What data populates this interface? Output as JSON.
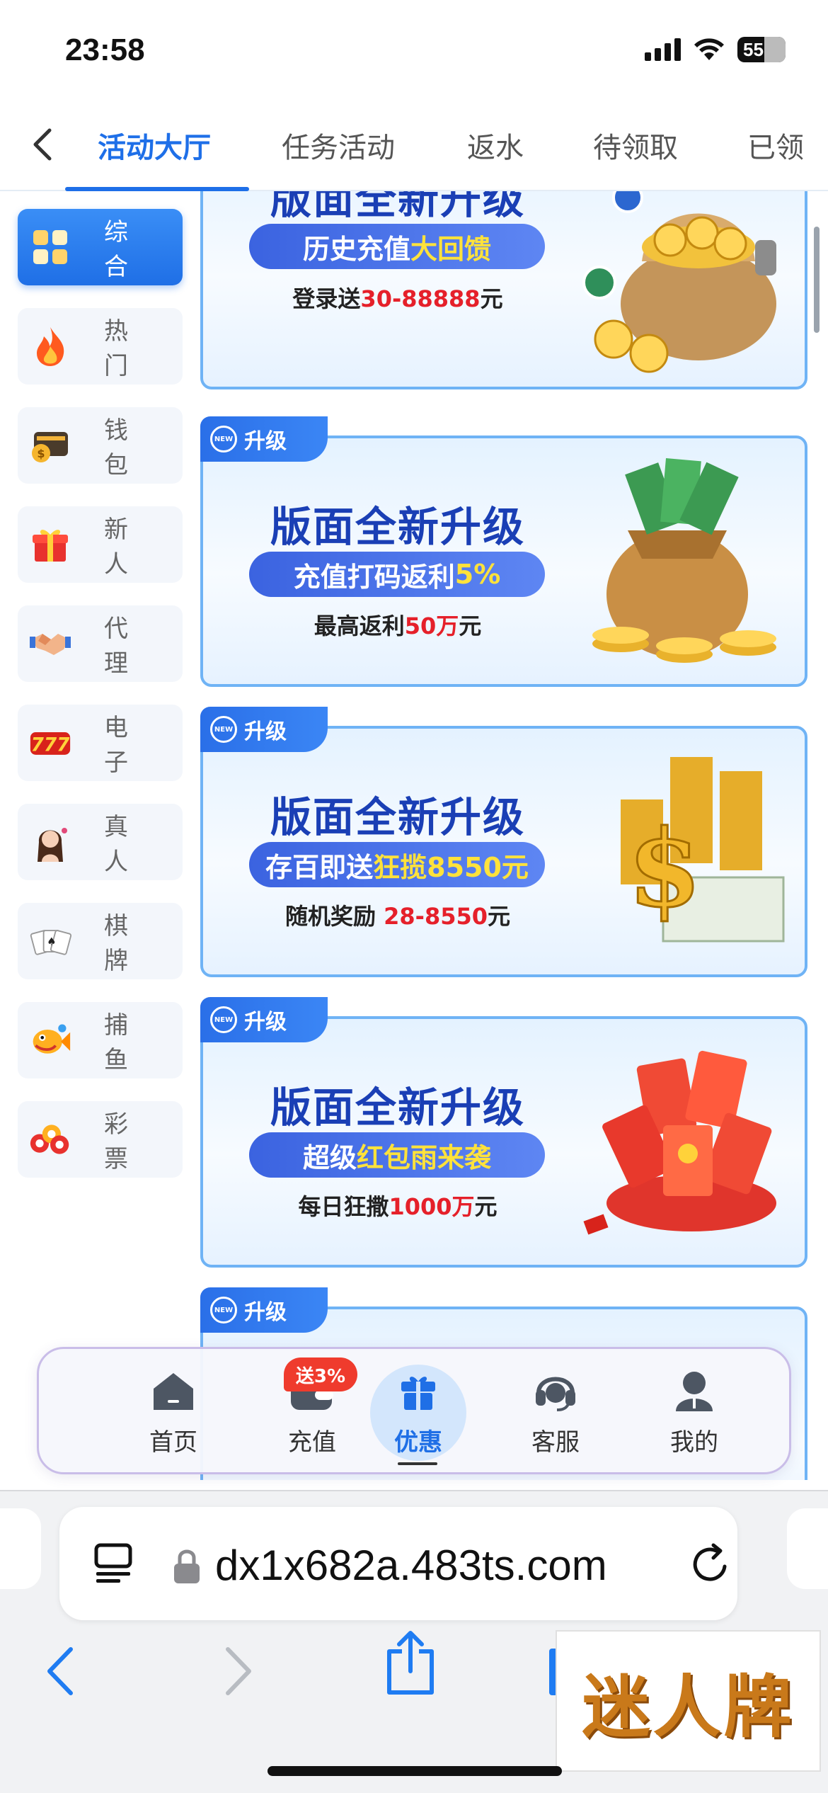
{
  "status_bar": {
    "time": "23:58",
    "battery": "55"
  },
  "tabs": [
    {
      "label": "活动大厅",
      "active": true
    },
    {
      "label": "任务活动",
      "active": false
    },
    {
      "label": "返水",
      "active": false
    },
    {
      "label": "待领取",
      "active": false
    },
    {
      "label": "已领"
    }
  ],
  "sidebar": [
    {
      "label": "综 合",
      "icon": "grid-icon",
      "active": true
    },
    {
      "label": "热 门",
      "icon": "fire-icon"
    },
    {
      "label": "钱 包",
      "icon": "wallet-icon"
    },
    {
      "label": "新 人",
      "icon": "gift-icon"
    },
    {
      "label": "代 理",
      "icon": "handshake-icon"
    },
    {
      "label": "电 子",
      "icon": "slot-777-icon"
    },
    {
      "label": "真 人",
      "icon": "dealer-avatar-icon"
    },
    {
      "label": "棋 牌",
      "icon": "playing-cards-icon"
    },
    {
      "label": "捕 鱼",
      "icon": "fish-icon"
    },
    {
      "label": "彩 票",
      "icon": "lottery-balls-icon"
    }
  ],
  "banners": [
    {
      "badge": "",
      "title": "版面全新升级",
      "pill_pre": "历史充值",
      "pill_hl": "大回馈",
      "sub_pre": "登录送",
      "sub_hl": "30-88888",
      "sub_post": "元",
      "art": "coin-bag"
    },
    {
      "badge": "升级",
      "title": "版面全新升级",
      "pill_pre": "充值打码返利",
      "pill_hl": "5%",
      "sub_pre": "最高返利",
      "sub_hl": "50万",
      "sub_post": "元",
      "art": "money-bag"
    },
    {
      "badge": "升级",
      "title": "版面全新升级",
      "pill_pre": "存百即送 ",
      "pill_hl": "狂揽8550元",
      "sub_pre": "随机奖励 ",
      "sub_hl": "28-8550",
      "sub_post": "元",
      "art": "dollar-coins"
    },
    {
      "badge": "升级",
      "title": "版面全新升级",
      "pill_pre": "超级",
      "pill_hl": "红包雨来袭",
      "sub_pre": "每日狂撒",
      "sub_hl": "1000万",
      "sub_post": "元",
      "art": "red-envelopes"
    },
    {
      "badge": "升级",
      "title": "",
      "pill_pre": "",
      "pill_hl": "",
      "sub_pre": "",
      "sub_hl": "",
      "sub_post": "",
      "art": "partial"
    }
  ],
  "bottom_nav": [
    {
      "label": "首页",
      "icon": "home-icon"
    },
    {
      "label": "充值",
      "icon": "wallet-icon",
      "badge": "送3%"
    },
    {
      "label": "优惠",
      "icon": "gift-box-icon",
      "active": true
    },
    {
      "label": "客服",
      "icon": "headset-icon"
    },
    {
      "label": "我的",
      "icon": "user-icon"
    }
  ],
  "browser": {
    "url": "dx1x682a.483ts.com"
  },
  "watermark": "迷人牌",
  "colors": {
    "accent": "#1e6fe8",
    "highlight_red": "#e5202a",
    "highlight_yellow": "#ffe23b",
    "badge_red": "#ef3b2d"
  }
}
